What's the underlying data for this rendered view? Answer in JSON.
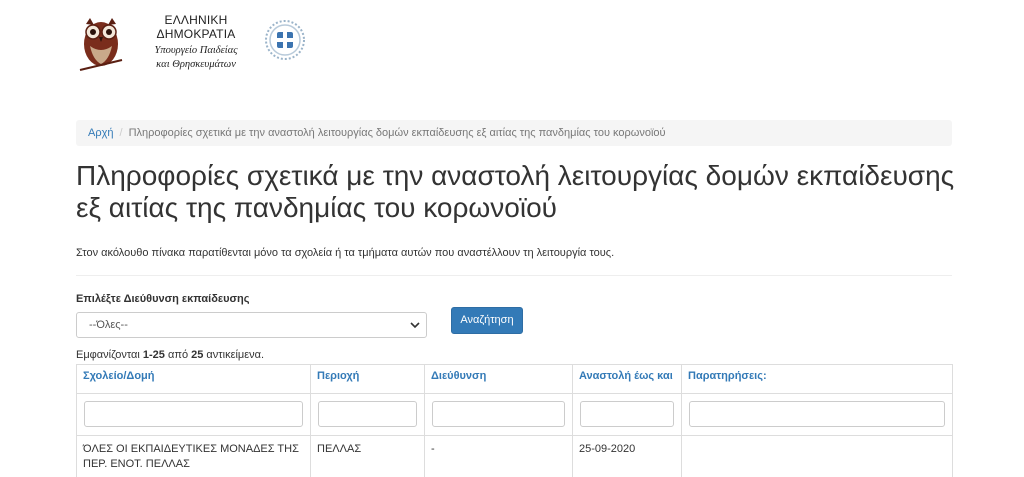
{
  "header": {
    "ministry_title": "ΕΛΛΗΝΙΚΗ ΔΗΜΟΚΡΑΤΙΑ",
    "ministry_line1": "Υπουργείο Παιδείας",
    "ministry_line2": "και Θρησκευμάτων"
  },
  "breadcrumb": {
    "home": "Αρχή",
    "separator": "/",
    "current": "Πληροφορίες σχετικά με την αναστολή λειτουργίας δομών εκπαίδευσης εξ αιτίας της πανδημίας του κορωνοϊού"
  },
  "page_title": "Πληροφορίες σχετικά με την αναστολή λειτουργίας δομών εκπαίδευσης εξ αιτίας της πανδημίας του κορωνοϊού",
  "intro": "Στον ακόλουθο πίνακα παρατίθενται μόνο τα σχολεία ή τα τμήματα αυτών που αναστέλλουν τη λειτουργία τους.",
  "filter": {
    "label": "Επιλέξτε Διεύθυνση εκπαίδευσης",
    "selected": "--Όλες--",
    "search_button": "Αναζήτηση"
  },
  "summary": {
    "prefix": "Εμφανίζονται ",
    "range": "1-25",
    "middle": " από ",
    "total": "25",
    "suffix": " αντικείμενα."
  },
  "table": {
    "columns": [
      "Σχολείο/Δομή",
      "Περιοχή",
      "Διεύθυνση",
      "Αναστολή έως και",
      "Παρατηρήσεις:"
    ],
    "rows": [
      [
        "ΌΛΕΣ ΟΙ ΕΚΠΑΙΔΕΥΤΙΚΕΣ ΜΟΝΑΔΕΣ ΤΗΣ ΠΕΡ. ΕΝΟΤ. ΠΕΛΛΑΣ",
        "ΠΕΛΛΑΣ",
        "-",
        "25-09-2020",
        ""
      ]
    ]
  },
  "colors": {
    "link": "#337ab7",
    "button_bg": "#337ab7",
    "breadcrumb_bg": "#f5f5f5",
    "border": "#dddddd"
  }
}
